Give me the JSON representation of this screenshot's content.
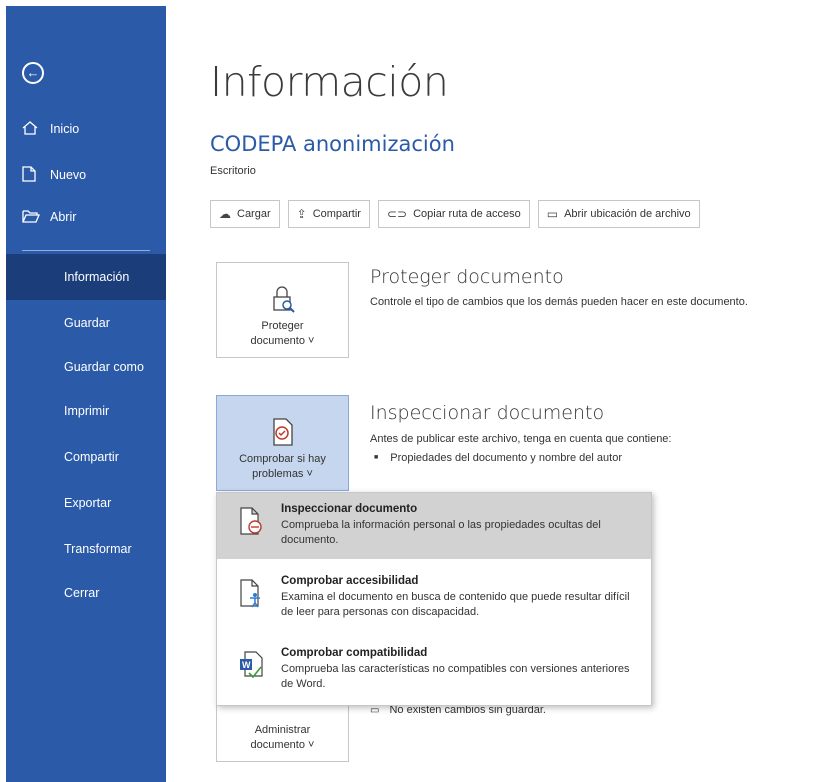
{
  "sidebar": {
    "back_icon": "back-arrow-icon",
    "top_items": [
      {
        "label": "Inicio",
        "icon": "home-icon"
      },
      {
        "label": "Nuevo",
        "icon": "new-document-icon"
      },
      {
        "label": "Abrir",
        "icon": "folder-open-icon"
      }
    ],
    "items": [
      {
        "label": "Información",
        "active": true
      },
      {
        "label": "Guardar"
      },
      {
        "label": "Guardar como"
      },
      {
        "label": "Imprimir"
      },
      {
        "label": "Compartir"
      },
      {
        "label": "Exportar"
      },
      {
        "label": "Transformar"
      },
      {
        "label": "Cerrar"
      }
    ]
  },
  "main": {
    "title": "Información",
    "doc_name": "CODEPA anonimización",
    "doc_location": "Escritorio",
    "actions": [
      {
        "label": "Cargar",
        "icon": "cloud-upload-icon"
      },
      {
        "label": "Compartir",
        "icon": "share-icon"
      },
      {
        "label": "Copiar ruta de acceso",
        "icon": "link-icon"
      },
      {
        "label": "Abrir ubicación de archivo",
        "icon": "folder-icon"
      }
    ],
    "protect": {
      "tile_line1": "Proteger",
      "tile_line2": "documento ˅",
      "title": "Proteger documento",
      "desc": "Controle el tipo de cambios que los demás pueden hacer en este documento."
    },
    "inspect": {
      "tile_line1": "Comprobar si hay",
      "tile_line2": "problemas ˅",
      "title": "Inspeccionar documento",
      "desc": "Antes de publicar este archivo, tenga en cuenta que contiene:",
      "bullets": [
        "Propiedades del documento y nombre del autor"
      ]
    },
    "manage": {
      "tile_line1": "Administrar",
      "tile_line2": "documento ˅",
      "unsaved": "No existen cambios sin guardar."
    }
  },
  "menu": {
    "items": [
      {
        "title": "Inspeccionar documento",
        "desc": "Comprueba la información personal o las propiedades ocultas del documento.",
        "icon": "inspect-document-icon"
      },
      {
        "title": "Comprobar accesibilidad",
        "desc": "Examina el documento en busca de contenido que puede resultar difícil de leer para personas con discapacidad.",
        "icon": "accessibility-icon"
      },
      {
        "title": "Comprobar compatibilidad",
        "desc": "Comprueba las características no compatibles con versiones anteriores de Word.",
        "icon": "compatibility-icon"
      }
    ]
  }
}
